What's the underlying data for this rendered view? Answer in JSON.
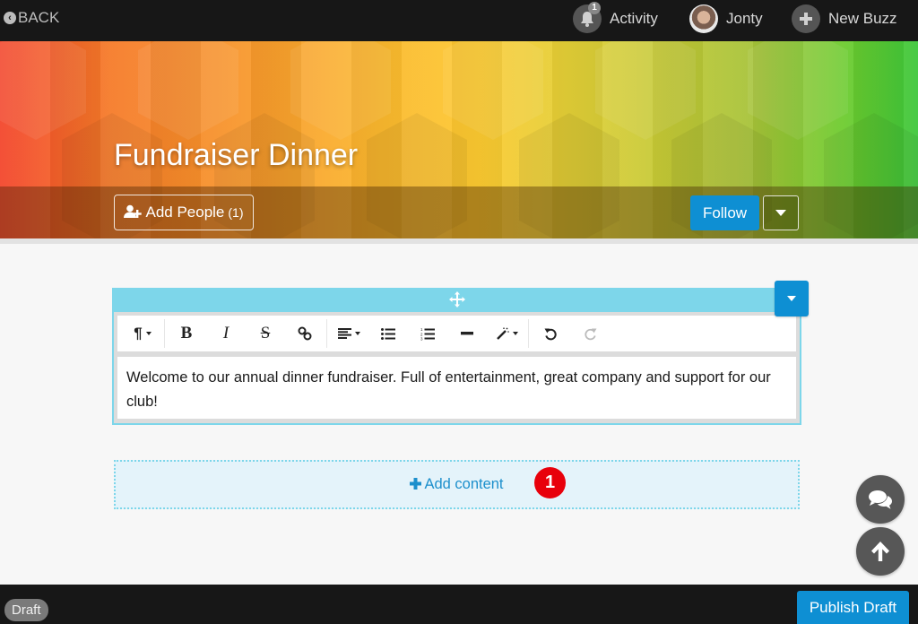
{
  "topbar": {
    "back_label": "BACK",
    "activity_label": "Activity",
    "activity_badge": "1",
    "user_name": "Jonty",
    "new_buzz_label": "New Buzz"
  },
  "hero": {
    "title": "Fundraiser Dinner",
    "add_people_label": "Add People",
    "add_people_count": "(1)",
    "follow_label": "Follow"
  },
  "editor": {
    "toolbar": [
      {
        "name": "paragraph-format",
        "glyph": "¶",
        "caret": true
      },
      {
        "name": "bold",
        "glyph": "B"
      },
      {
        "name": "italic",
        "glyph": "I"
      },
      {
        "name": "strikethrough",
        "glyph": "S"
      },
      {
        "name": "link",
        "glyph": "🔗"
      },
      {
        "name": "align",
        "glyph": "≡",
        "caret": true
      },
      {
        "name": "bullet-list",
        "glyph": "☰"
      },
      {
        "name": "numbered-list",
        "glyph": "☰"
      },
      {
        "name": "horizontal-rule",
        "glyph": "—"
      },
      {
        "name": "magic-format",
        "glyph": "✎",
        "caret": true
      },
      {
        "name": "undo",
        "glyph": "↺"
      },
      {
        "name": "redo",
        "glyph": "↻",
        "disabled": true
      }
    ],
    "body_text": "Welcome to our annual dinner fundraiser. Full of entertainment, great company and support for our club!"
  },
  "add_content": {
    "label": "Add content",
    "step_badge": "1"
  },
  "bottombar": {
    "status_badge": "Draft",
    "publish_label": "Publish Draft"
  },
  "colors": {
    "accent_blue": "#0e8fd3",
    "editor_border": "#7dd6ea",
    "step_badge_red": "#e8000b",
    "topbar_bg": "#171717"
  }
}
